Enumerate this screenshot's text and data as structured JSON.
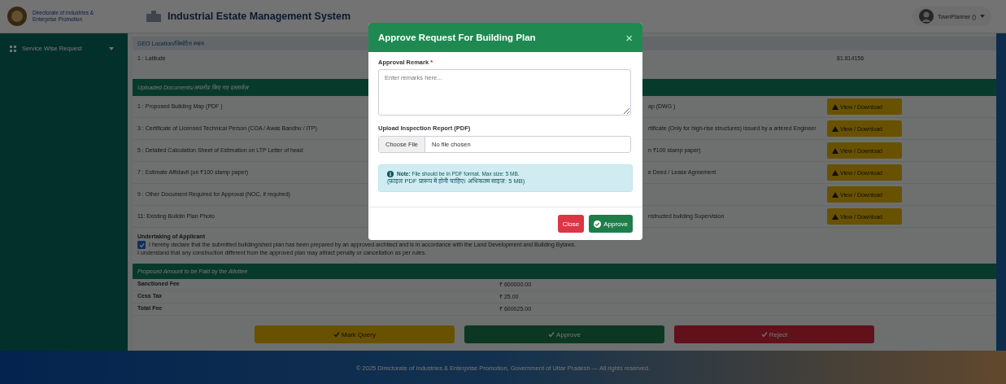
{
  "header": {
    "org_name": "Directorate of Industries & Enterprise Promotion",
    "app_title": "Industrial Estate Management System",
    "user": "TownPlanner ()"
  },
  "sidebar": {
    "items": [
      {
        "label": "Service Wise Request",
        "expanded": true
      }
    ]
  },
  "geo_section": {
    "title": "GEO Location/जियोटैग स्थान",
    "rows": [
      {
        "label": "1 : Latitude",
        "value": "81.814156"
      }
    ]
  },
  "documents_section": {
    "title": "Uploaded Documents/अपलोड किए गए दस्तावेज़",
    "rows": [
      {
        "left_label": "1 : Proposed Building Map (PDF )",
        "right_label": "ap (DWG )",
        "button": "View / Download"
      },
      {
        "left_label": "3 : Certificate of Licensed Technical Person (COA / Awas Bandhu / ITP)",
        "right_label": "rtificate (Only for high-rise structures) issued by a artered Engineer",
        "button": "View / Download"
      },
      {
        "left_label": "5 : Detailed Calculation Sheet of Estimation on LTP Letter of head",
        "right_label": "n ₹100 stamp paper)",
        "button": "View / Download"
      },
      {
        "left_label": "7 : Estimate Affidavit (on ₹100 stamp paper)",
        "right_label": "e Deed / Lease Agreement",
        "button": "View / Download"
      },
      {
        "left_label": "9 : Other Document Required for Approval (NOC, if required)",
        "button": "View / Download"
      },
      {
        "left_label": "11: Existing Buildin Plan Photo",
        "right_label": "nstructed building Supervision",
        "button": "View / Download"
      }
    ]
  },
  "undertaking": {
    "title": "Undertaking of Applicant",
    "checked": true,
    "declaration": "I hereby declare that the submitted building/shed plan has been prepared by an approved architect and is in accordance with the Land Development and Building Bylaws.",
    "note": "I understand that any construction different from the approved plan may attract penalty or cancellation as per rules."
  },
  "amount_section": {
    "title": "Proposed Amount to be Paid by the Allottee",
    "rows": [
      {
        "label": "Sanctioned Fee",
        "value": "₹ 600000.00"
      },
      {
        "label": "Cess Tax",
        "value": "₹ 25.00"
      },
      {
        "label": "Total Fee",
        "value": "₹ 600025.00"
      }
    ]
  },
  "actions": [
    {
      "label": "Mark Query",
      "kind": "query"
    },
    {
      "label": "Approve",
      "kind": "approve"
    },
    {
      "label": "Reject",
      "kind": "reject"
    }
  ],
  "footer": "© 2025 Directorate of Industries & Enterprise Promotion, Government of Uttar Pradesh — All rights reserved.",
  "modal": {
    "title": "Approve Request For Building Plan",
    "close_symbol": "×",
    "remark_label": "Approval Remark",
    "required_mark": "*",
    "remark_placeholder": "Enter remarks here...",
    "upload_label": "Upload Inspection Report (PDF)",
    "file_button": "Choose File",
    "file_status": "No file chosen",
    "note": "**Note:** File should be in PDF format. Max size: 5 MB.",
    "note_hindi": "(फ़ाइल PDF प्रारूप में होनी चाहिए। अधिकतम साइज़: 5 MB)",
    "buttons": [
      {
        "label": "Close",
        "kind": "close"
      },
      {
        "label": "Approve",
        "kind": "approve"
      }
    ]
  }
}
